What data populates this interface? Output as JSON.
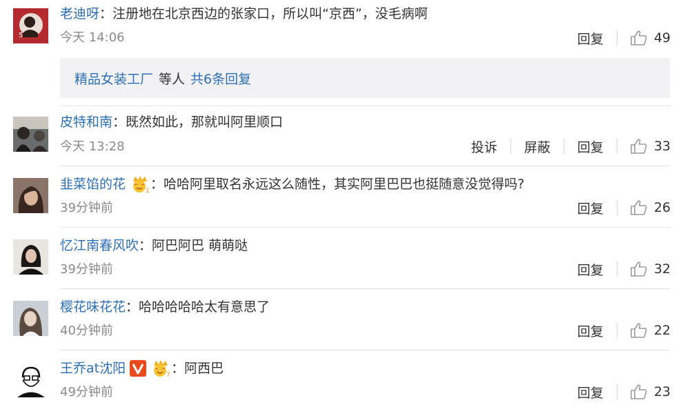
{
  "comments": [
    {
      "username": "老迪呀",
      "text": "注册地在北京西边的张家口，所以叫“京西”，没毛病啊",
      "time": "今天 14:06",
      "actions": [
        "回复"
      ],
      "likes": "49",
      "replies_box": {
        "user": "精品女装工厂",
        "middle": "等人",
        "link": "共6条回复"
      }
    },
    {
      "username": "皮特和南",
      "text": "既然如此，那就叫阿里顺口",
      "time": "今天 13:28",
      "actions": [
        "投诉",
        "屏蔽",
        "回复"
      ],
      "likes": "33"
    },
    {
      "username": "韭菜馅的花",
      "badge": "crown-emoji",
      "badge_number": "1",
      "text": "哈哈阿里取名永远这么随性，其实阿里巴巴也挺随意没觉得吗?",
      "time": "39分钟前",
      "actions": [
        "回复"
      ],
      "likes": "26"
    },
    {
      "username": "忆江南春风吹",
      "text": "阿巴阿巴 萌萌哒",
      "time": "39分钟前",
      "actions": [
        "回复"
      ],
      "likes": "32"
    },
    {
      "username": "樱花味花花",
      "text": "哈哈哈哈哈太有意思了",
      "time": "40分钟前",
      "actions": [
        "回复"
      ],
      "likes": "22"
    },
    {
      "username": "王乔at沈阳",
      "badge": "verified-v",
      "badge2": "crown-emoji",
      "badge2_number": "7",
      "text": "阿西巴",
      "time": "49分钟前",
      "actions": [
        "回复"
      ],
      "likes": "23"
    }
  ],
  "colon": "：",
  "colors": {
    "username": "#2d6fb4",
    "time": "#8a8a8a",
    "reply_box_bg": "#f2f2f5",
    "verified": "#e8491d"
  }
}
